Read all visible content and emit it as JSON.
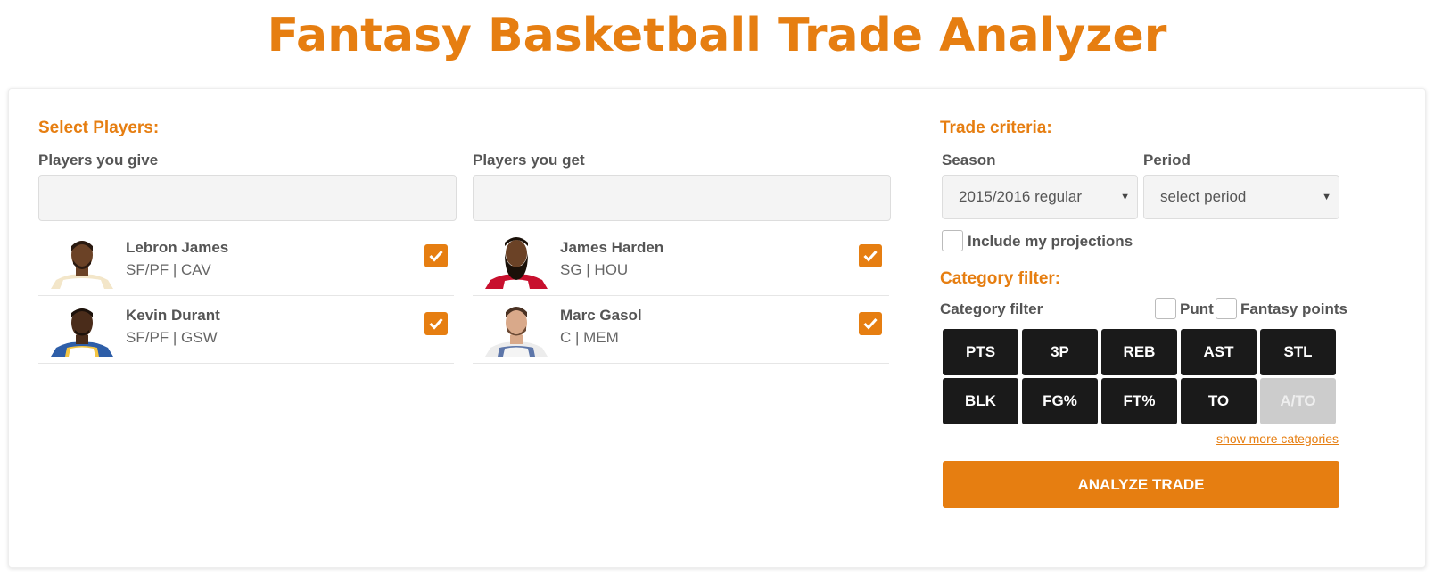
{
  "title": "Fantasy Basketball Trade Analyzer",
  "select_players": {
    "heading": "Select Players:",
    "give": {
      "label": "Players you give",
      "players": [
        {
          "name": "Lebron James",
          "meta": "SF/PF | CAV",
          "checked": true
        },
        {
          "name": "Kevin Durant",
          "meta": "SF/PF | GSW",
          "checked": true
        }
      ]
    },
    "get": {
      "label": "Players you get",
      "players": [
        {
          "name": "James Harden",
          "meta": "SG | HOU",
          "checked": true
        },
        {
          "name": "Marc Gasol",
          "meta": "C | MEM",
          "checked": true
        }
      ]
    }
  },
  "trade_criteria": {
    "heading": "Trade criteria:",
    "season_label": "Season",
    "season_value": "2015/2016 regular",
    "period_label": "Period",
    "period_value": "select period",
    "include_projections_label": "Include my projections",
    "include_projections_checked": false
  },
  "category_filter": {
    "heading": "Category filter:",
    "label": "Category filter",
    "punt_label": "Punt",
    "fantasy_points_label": "Fantasy points",
    "categories": [
      {
        "label": "PTS",
        "active": true
      },
      {
        "label": "3P",
        "active": true
      },
      {
        "label": "REB",
        "active": true
      },
      {
        "label": "AST",
        "active": true
      },
      {
        "label": "STL",
        "active": true
      },
      {
        "label": "BLK",
        "active": true
      },
      {
        "label": "FG%",
        "active": true
      },
      {
        "label": "FT%",
        "active": true
      },
      {
        "label": "TO",
        "active": true
      },
      {
        "label": "A/TO",
        "active": false
      }
    ],
    "show_more_label": "show more categories"
  },
  "analyze_button_label": "ANALYZE TRADE",
  "colors": {
    "accent": "#e67e11",
    "category_active": "#1a1a1a",
    "category_inactive": "#cccccc"
  }
}
